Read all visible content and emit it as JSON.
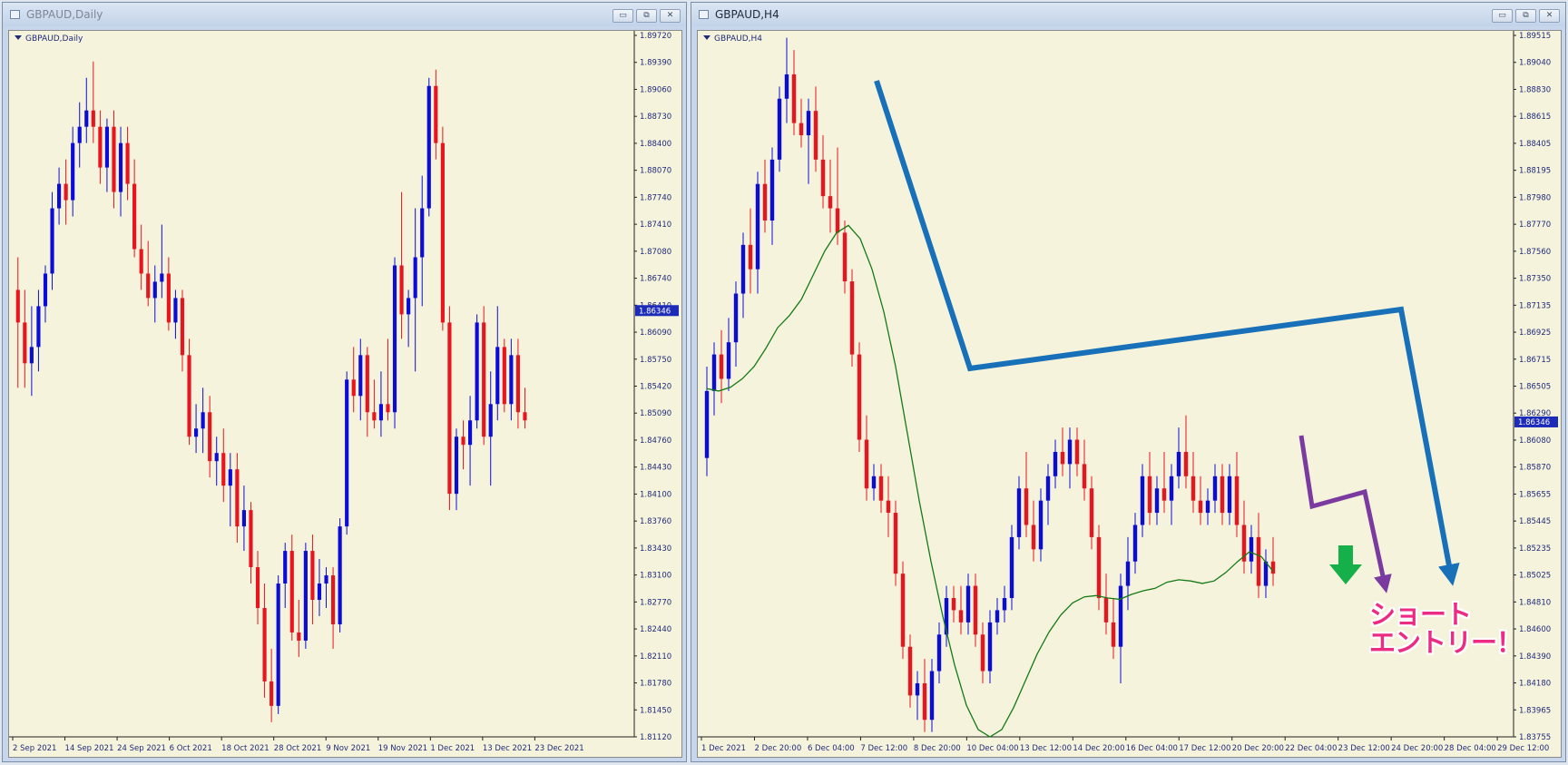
{
  "colors": {
    "bull": "#0c0cd8",
    "bear": "#e8141e",
    "ma": "#157a15",
    "bg": "#f5f3dc",
    "axis": "#1f2a7a",
    "trend_blue": "#1870b8",
    "trend_purple": "#7b3aa0",
    "arrow_green": "#16b04a",
    "annotation": "#ec2b83"
  },
  "windows": [
    {
      "title": "GBPAUD,Daily",
      "chart_label": "GBPAUD,Daily",
      "buttons": [
        "minimize-icon",
        "restore-icon",
        "close-icon"
      ],
      "button_glyphs": [
        "▭",
        "⧉",
        "✕"
      ]
    },
    {
      "title": "GBPAUD,H4",
      "chart_label": "GBPAUD,H4",
      "buttons": [
        "minimize-icon",
        "restore-icon",
        "close-icon"
      ],
      "button_glyphs": [
        "▭",
        "⧉",
        "✕"
      ]
    }
  ],
  "annotation": {
    "line1": "ショート",
    "line2": "エントリー！"
  },
  "chart_data": [
    {
      "type": "candlestick",
      "symbol": "GBPAUD",
      "timeframe": "Daily",
      "ylim": [
        1.8112,
        1.8972
      ],
      "y_ticks": [
        "1.89720",
        "1.89390",
        "1.89060",
        "1.88730",
        "1.88400",
        "1.88070",
        "1.87740",
        "1.87410",
        "1.87080",
        "1.86740",
        "1.86410",
        "1.86090",
        "1.85750",
        "1.85420",
        "1.85090",
        "1.84760",
        "1.84430",
        "1.84100",
        "1.83760",
        "1.83430",
        "1.83100",
        "1.82770",
        "1.82440",
        "1.82110",
        "1.81780",
        "1.81450",
        "1.81120"
      ],
      "x_labels": [
        "2 Sep 2021",
        "14 Sep 2021",
        "24 Sep 2021",
        "6 Oct 2021",
        "18 Oct 2021",
        "28 Oct 2021",
        "9 Nov 2021",
        "19 Nov 2021",
        "1 Dec 2021",
        "13 Dec 2021",
        "23 Dec 2021"
      ],
      "current_price": "1.86346",
      "candles": [
        [
          1.866,
          1.87,
          1.854,
          1.862
        ],
        [
          1.862,
          1.866,
          1.854,
          1.857
        ],
        [
          1.857,
          1.864,
          1.853,
          1.859
        ],
        [
          1.859,
          1.866,
          1.856,
          1.864
        ],
        [
          1.864,
          1.869,
          1.862,
          1.868
        ],
        [
          1.868,
          1.878,
          1.866,
          1.876
        ],
        [
          1.876,
          1.881,
          1.874,
          1.879
        ],
        [
          1.879,
          1.882,
          1.874,
          1.877
        ],
        [
          1.877,
          1.886,
          1.875,
          1.884
        ],
        [
          1.884,
          1.889,
          1.881,
          1.886
        ],
        [
          1.886,
          1.892,
          1.884,
          1.888
        ],
        [
          1.888,
          1.894,
          1.884,
          1.886
        ],
        [
          1.886,
          1.888,
          1.879,
          1.881
        ],
        [
          1.881,
          1.887,
          1.878,
          1.886
        ],
        [
          1.886,
          1.888,
          1.876,
          1.878
        ],
        [
          1.878,
          1.886,
          1.875,
          1.884
        ],
        [
          1.884,
          1.886,
          1.877,
          1.879
        ],
        [
          1.879,
          1.882,
          1.87,
          1.871
        ],
        [
          1.871,
          1.874,
          1.866,
          1.868
        ],
        [
          1.868,
          1.872,
          1.864,
          1.865
        ],
        [
          1.865,
          1.869,
          1.862,
          1.867
        ],
        [
          1.867,
          1.874,
          1.865,
          1.868
        ],
        [
          1.868,
          1.87,
          1.861,
          1.862
        ],
        [
          1.862,
          1.866,
          1.86,
          1.865
        ],
        [
          1.865,
          1.866,
          1.856,
          1.858
        ],
        [
          1.858,
          1.86,
          1.847,
          1.848
        ],
        [
          1.848,
          1.852,
          1.846,
          1.849
        ],
        [
          1.849,
          1.854,
          1.846,
          1.851
        ],
        [
          1.851,
          1.853,
          1.843,
          1.845
        ],
        [
          1.845,
          1.848,
          1.842,
          1.846
        ],
        [
          1.846,
          1.849,
          1.84,
          1.842
        ],
        [
          1.842,
          1.846,
          1.837,
          1.844
        ],
        [
          1.844,
          1.846,
          1.835,
          1.837
        ],
        [
          1.837,
          1.842,
          1.834,
          1.839
        ],
        [
          1.839,
          1.84,
          1.83,
          1.832
        ],
        [
          1.832,
          1.834,
          1.825,
          1.827
        ],
        [
          1.827,
          1.83,
          1.816,
          1.818
        ],
        [
          1.818,
          1.822,
          1.813,
          1.815
        ],
        [
          1.815,
          1.831,
          1.814,
          1.83
        ],
        [
          1.83,
          1.835,
          1.827,
          1.834
        ],
        [
          1.834,
          1.836,
          1.823,
          1.824
        ],
        [
          1.824,
          1.828,
          1.821,
          1.823
        ],
        [
          1.823,
          1.835,
          1.822,
          1.834
        ],
        [
          1.834,
          1.836,
          1.825,
          1.828
        ],
        [
          1.828,
          1.833,
          1.826,
          1.83
        ],
        [
          1.83,
          1.832,
          1.827,
          1.831
        ],
        [
          1.831,
          1.832,
          1.822,
          1.825
        ],
        [
          1.825,
          1.838,
          1.824,
          1.837
        ],
        [
          1.837,
          1.856,
          1.836,
          1.855
        ],
        [
          1.855,
          1.859,
          1.851,
          1.853
        ],
        [
          1.853,
          1.86,
          1.85,
          1.858
        ],
        [
          1.858,
          1.859,
          1.848,
          1.851
        ],
        [
          1.851,
          1.855,
          1.849,
          1.85
        ],
        [
          1.85,
          1.856,
          1.848,
          1.852
        ],
        [
          1.852,
          1.86,
          1.85,
          1.851
        ],
        [
          1.851,
          1.87,
          1.849,
          1.869
        ],
        [
          1.869,
          1.878,
          1.86,
          1.863
        ],
        [
          1.863,
          1.866,
          1.859,
          1.865
        ],
        [
          1.865,
          1.876,
          1.856,
          1.87
        ],
        [
          1.87,
          1.88,
          1.864,
          1.876
        ],
        [
          1.876,
          1.892,
          1.875,
          1.891
        ],
        [
          1.891,
          1.893,
          1.882,
          1.884
        ],
        [
          1.884,
          1.886,
          1.861,
          1.862
        ],
        [
          1.862,
          1.864,
          1.839,
          1.841
        ],
        [
          1.841,
          1.849,
          1.839,
          1.848
        ],
        [
          1.848,
          1.85,
          1.844,
          1.847
        ],
        [
          1.847,
          1.853,
          1.842,
          1.85
        ],
        [
          1.85,
          1.863,
          1.849,
          1.862
        ],
        [
          1.862,
          1.864,
          1.847,
          1.848
        ],
        [
          1.848,
          1.856,
          1.842,
          1.852
        ],
        [
          1.852,
          1.864,
          1.85,
          1.859
        ],
        [
          1.859,
          1.86,
          1.851,
          1.852
        ],
        [
          1.852,
          1.86,
          1.85,
          1.858
        ],
        [
          1.858,
          1.86,
          1.849,
          1.851
        ],
        [
          1.851,
          1.854,
          1.849,
          1.85
        ]
      ]
    },
    {
      "type": "candlestick",
      "symbol": "GBPAUD",
      "timeframe": "H4",
      "ylim": [
        1.8376,
        1.8952
      ],
      "y_ticks": [
        "1.89515",
        "1.89040",
        "1.88830",
        "1.88615",
        "1.88405",
        "1.88195",
        "1.87980",
        "1.87770",
        "1.87560",
        "1.87350",
        "1.87135",
        "1.86925",
        "1.86715",
        "1.86505",
        "1.86290",
        "1.86080",
        "1.85870",
        "1.85655",
        "1.85445",
        "1.85235",
        "1.85025",
        "1.84810",
        "1.84600",
        "1.84390",
        "1.84180",
        "1.83965",
        "1.83755"
      ],
      "x_labels": [
        "1 Dec 2021",
        "2 Dec 20:00",
        "6 Dec 04:00",
        "7 Dec 12:00",
        "8 Dec 20:00",
        "10 Dec 04:00",
        "13 Dec 12:00",
        "14 Dec 20:00",
        "16 Dec 04:00",
        "17 Dec 12:00",
        "20 Dec 20:00",
        "22 Dec 04:00",
        "23 Dec 12:00",
        "24 Dec 20:00",
        "28 Dec 04:00",
        "29 Dec 12:00"
      ],
      "current_price": "1.86346",
      "ma_period_label": "",
      "candles": [
        [
          1.8605,
          1.868,
          1.859,
          1.866
        ],
        [
          1.866,
          1.87,
          1.864,
          1.869
        ],
        [
          1.869,
          1.871,
          1.865,
          1.867
        ],
        [
          1.867,
          1.872,
          1.866,
          1.87
        ],
        [
          1.87,
          1.875,
          1.868,
          1.874
        ],
        [
          1.874,
          1.879,
          1.872,
          1.878
        ],
        [
          1.878,
          1.881,
          1.874,
          1.876
        ],
        [
          1.876,
          1.884,
          1.874,
          1.883
        ],
        [
          1.883,
          1.885,
          1.879,
          1.88
        ],
        [
          1.88,
          1.886,
          1.878,
          1.885
        ],
        [
          1.885,
          1.891,
          1.884,
          1.89
        ],
        [
          1.89,
          1.895,
          1.888,
          1.892
        ],
        [
          1.892,
          1.894,
          1.887,
          1.888
        ],
        [
          1.888,
          1.89,
          1.886,
          1.887
        ],
        [
          1.887,
          1.89,
          1.883,
          1.889
        ],
        [
          1.889,
          1.891,
          1.884,
          1.885
        ],
        [
          1.885,
          1.887,
          1.881,
          1.882
        ],
        [
          1.882,
          1.885,
          1.879,
          1.881
        ],
        [
          1.881,
          1.886,
          1.878,
          1.879
        ],
        [
          1.879,
          1.88,
          1.874,
          1.875
        ],
        [
          1.875,
          1.876,
          1.868,
          1.869
        ],
        [
          1.869,
          1.87,
          1.861,
          1.862
        ],
        [
          1.862,
          1.864,
          1.857,
          1.858
        ],
        [
          1.858,
          1.86,
          1.857,
          1.859
        ],
        [
          1.859,
          1.86,
          1.856,
          1.857
        ],
        [
          1.857,
          1.859,
          1.854,
          1.856
        ],
        [
          1.856,
          1.857,
          1.85,
          1.851
        ],
        [
          1.851,
          1.852,
          1.844,
          1.845
        ],
        [
          1.845,
          1.846,
          1.84,
          1.841
        ],
        [
          1.841,
          1.843,
          1.839,
          1.842
        ],
        [
          1.842,
          1.844,
          1.838,
          1.839
        ],
        [
          1.839,
          1.844,
          1.838,
          1.843
        ],
        [
          1.843,
          1.847,
          1.842,
          1.846
        ],
        [
          1.846,
          1.85,
          1.845,
          1.849
        ],
        [
          1.849,
          1.85,
          1.847,
          1.848
        ],
        [
          1.848,
          1.85,
          1.846,
          1.847
        ],
        [
          1.847,
          1.851,
          1.846,
          1.85
        ],
        [
          1.85,
          1.851,
          1.845,
          1.846
        ],
        [
          1.846,
          1.847,
          1.842,
          1.843
        ],
        [
          1.843,
          1.848,
          1.842,
          1.847
        ],
        [
          1.847,
          1.849,
          1.846,
          1.848
        ],
        [
          1.848,
          1.85,
          1.847,
          1.849
        ],
        [
          1.849,
          1.855,
          1.848,
          1.854
        ],
        [
          1.854,
          1.859,
          1.853,
          1.858
        ],
        [
          1.858,
          1.861,
          1.854,
          1.855
        ],
        [
          1.855,
          1.857,
          1.852,
          1.853
        ],
        [
          1.853,
          1.858,
          1.852,
          1.857
        ],
        [
          1.857,
          1.86,
          1.855,
          1.859
        ],
        [
          1.859,
          1.862,
          1.858,
          1.861
        ],
        [
          1.861,
          1.863,
          1.859,
          1.86
        ],
        [
          1.86,
          1.863,
          1.858,
          1.862
        ],
        [
          1.862,
          1.863,
          1.859,
          1.86
        ],
        [
          1.86,
          1.862,
          1.857,
          1.858
        ],
        [
          1.858,
          1.859,
          1.853,
          1.854
        ],
        [
          1.854,
          1.855,
          1.848,
          1.849
        ],
        [
          1.849,
          1.851,
          1.846,
          1.847
        ],
        [
          1.847,
          1.849,
          1.844,
          1.845
        ],
        [
          1.845,
          1.851,
          1.842,
          1.85
        ],
        [
          1.85,
          1.854,
          1.848,
          1.852
        ],
        [
          1.852,
          1.856,
          1.851,
          1.855
        ],
        [
          1.855,
          1.86,
          1.854,
          1.859
        ],
        [
          1.859,
          1.861,
          1.855,
          1.856
        ],
        [
          1.856,
          1.859,
          1.855,
          1.858
        ],
        [
          1.858,
          1.861,
          1.856,
          1.857
        ],
        [
          1.857,
          1.86,
          1.855,
          1.859
        ],
        [
          1.859,
          1.863,
          1.858,
          1.861
        ],
        [
          1.861,
          1.864,
          1.858,
          1.859
        ],
        [
          1.859,
          1.861,
          1.856,
          1.857
        ],
        [
          1.857,
          1.859,
          1.855,
          1.856
        ],
        [
          1.856,
          1.858,
          1.855,
          1.857
        ],
        [
          1.857,
          1.86,
          1.856,
          1.859
        ],
        [
          1.859,
          1.86,
          1.855,
          1.856
        ],
        [
          1.856,
          1.86,
          1.855,
          1.859
        ],
        [
          1.859,
          1.861,
          1.854,
          1.855
        ],
        [
          1.855,
          1.857,
          1.851,
          1.852
        ],
        [
          1.852,
          1.855,
          1.851,
          1.854
        ],
        [
          1.854,
          1.856,
          1.849,
          1.85
        ],
        [
          1.85,
          1.853,
          1.849,
          1.852
        ],
        [
          1.852,
          1.854,
          1.85,
          1.851
        ]
      ],
      "moving_average": [
        1.8662,
        1.866,
        1.8663,
        1.867,
        1.868,
        1.8695,
        1.8712,
        1.8722,
        1.8735,
        1.8755,
        1.8775,
        1.879,
        1.8796,
        1.8785,
        1.876,
        1.8725,
        1.868,
        1.8625,
        1.857,
        1.852,
        1.8475,
        1.8435,
        1.8402,
        1.8382,
        1.8376,
        1.8382,
        1.84,
        1.8422,
        1.8444,
        1.8462,
        1.8476,
        1.8486,
        1.8491,
        1.8492,
        1.849,
        1.8489,
        1.8493,
        1.8496,
        1.8498,
        1.8503,
        1.8505,
        1.8504,
        1.8502,
        1.8504,
        1.8511,
        1.852,
        1.8528,
        1.8524,
        1.8512
      ]
    }
  ]
}
